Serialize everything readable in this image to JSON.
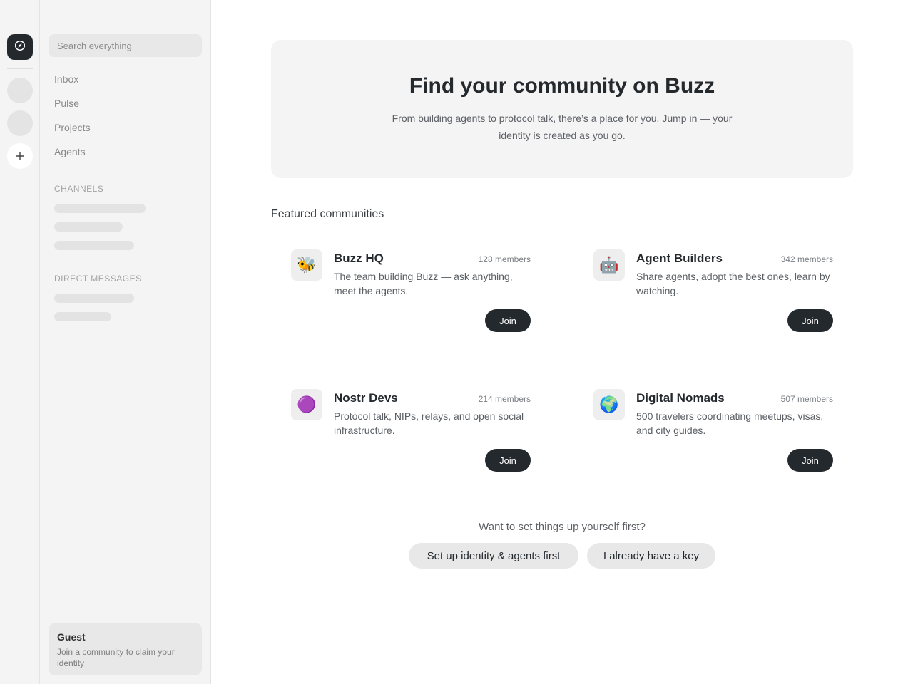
{
  "rail": {
    "active_icon": "compass-icon",
    "add_icon": "plus-icon"
  },
  "sidebar": {
    "search_placeholder": "Search everything",
    "nav": [
      "Inbox",
      "Pulse",
      "Projects",
      "Agents"
    ],
    "channels_title": "CHANNELS",
    "dm_title": "DIRECT MESSAGES",
    "guest": {
      "name": "Guest",
      "hint": "Join a community to claim your identity"
    }
  },
  "hero": {
    "title": "Find your community on Buzz",
    "subtitle": "From building agents to protocol talk, there’s a place for you. Jump in — your identity is created as you go."
  },
  "featured_title": "Featured communities",
  "communities": [
    {
      "icon": "🐝",
      "name": "Buzz HQ",
      "members": "128 members",
      "desc": "The team building Buzz — ask anything, meet the agents.",
      "join": "Join"
    },
    {
      "icon": "🤖",
      "name": "Agent Builders",
      "members": "342 members",
      "desc": "Share agents, adopt the best ones, learn by watching.",
      "join": "Join"
    },
    {
      "icon": "🟣",
      "name": "Nostr Devs",
      "members": "214 members",
      "desc": "Protocol talk, NIPs, relays, and open social infrastructure.",
      "join": "Join"
    },
    {
      "icon": "🌍",
      "name": "Digital Nomads",
      "members": "507 members",
      "desc": "500 travelers coordinating meetups, visas, and city guides.",
      "join": "Join"
    }
  ],
  "cta": {
    "question": "Want to set things up yourself first?",
    "setup_label": "Set up identity & agents first",
    "key_label": "I already have a key"
  }
}
